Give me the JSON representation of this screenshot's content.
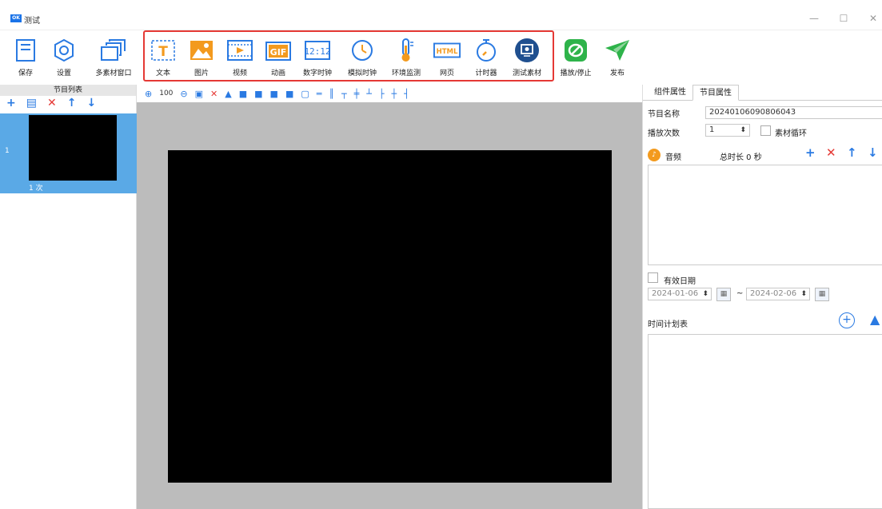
{
  "window": {
    "title": "测试",
    "min": "—",
    "max": "☐",
    "close": "✕"
  },
  "toolbar": {
    "save": "保存",
    "settings": "设置",
    "multi_window": "多素材窗口",
    "text": "文本",
    "image": "图片",
    "video": "视频",
    "animation": "动画",
    "digital_clock": "数字时钟",
    "analog_clock": "模拟时钟",
    "env_monitor": "环境监测",
    "webpage": "网页",
    "timer": "计时器",
    "test_material": "测试素材",
    "play_stop": "播放/停止",
    "publish": "发布"
  },
  "program_list": {
    "title": "节目列表",
    "items": [
      {
        "index": "1",
        "count": "1 次"
      }
    ]
  },
  "edit_toolbar": {
    "zoom": "100"
  },
  "right_panel": {
    "tabs": [
      "组件属性",
      "节目属性"
    ],
    "program_name_label": "节目名称",
    "program_name": "20240106090806043",
    "play_count_label": "播放次数",
    "play_count": "1",
    "material_loop_label": "素材循环",
    "audio_label": "音频",
    "total_duration": "总时长 0 秒",
    "valid_date_label": "有效日期",
    "date_start": "2024-01-06",
    "date_sep": "~",
    "date_end": "2024-02-06",
    "schedule_label": "时间计划表"
  },
  "colors": {
    "accent": "#2a7ae2",
    "highlight": "#e53935",
    "selected": "#5aa9e6",
    "canvas_bg": "#bcbcbc"
  }
}
